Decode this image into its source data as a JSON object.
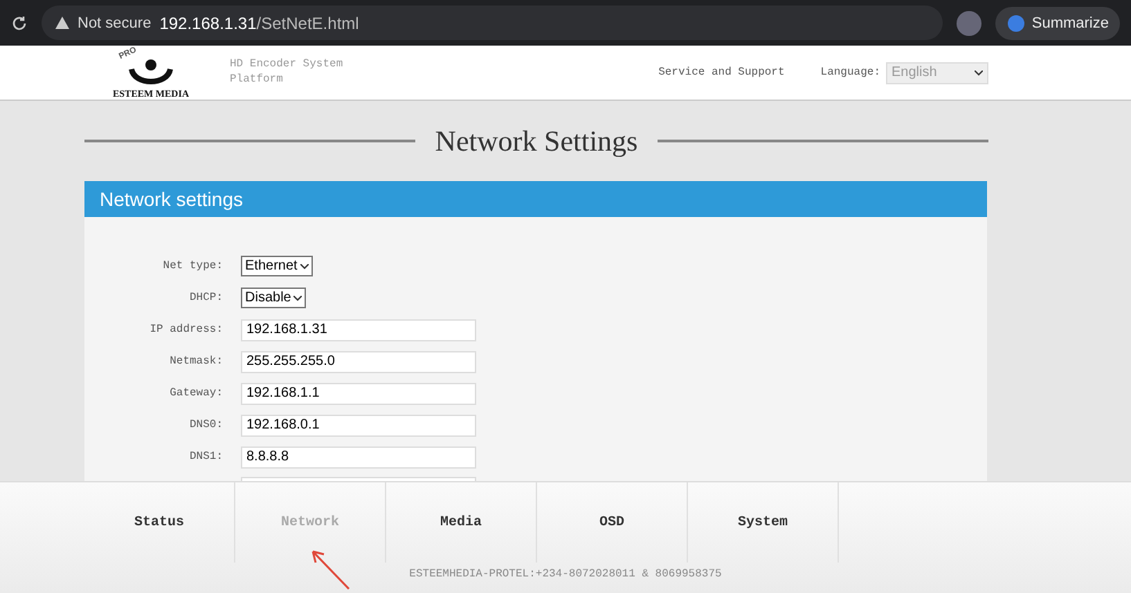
{
  "browser": {
    "security": "Not secure",
    "url_host": "192.168.1.31",
    "url_path": "/SetNetE.html",
    "summarize": "Summarize"
  },
  "header": {
    "logo_badge": "PRO",
    "logo_text": "ESTEEM MEDIA",
    "subtitle": "HD Encoder System Platform",
    "support_link": "Service and Support",
    "language_label": "Language:",
    "language_value": "English"
  },
  "page_title": "Network Settings",
  "panel": {
    "title": "Network settings",
    "fields": [
      {
        "kind": "select",
        "label": "Net type:",
        "value": "Ethernet"
      },
      {
        "kind": "select",
        "label": "DHCP:",
        "value": "Disable"
      },
      {
        "kind": "text",
        "label": "IP address:",
        "value": "192.168.1.31"
      },
      {
        "kind": "text",
        "label": "Netmask:",
        "value": "255.255.255.0"
      },
      {
        "kind": "text",
        "label": "Gateway:",
        "value": "192.168.1.1"
      },
      {
        "kind": "text",
        "label": "DNS0:",
        "value": "192.168.0.1"
      },
      {
        "kind": "text",
        "label": "DNS1:",
        "value": "8.8.8.8"
      },
      {
        "kind": "partial"
      }
    ]
  },
  "nav": [
    {
      "label": "Status",
      "selected": false
    },
    {
      "label": "Network",
      "selected": true
    },
    {
      "label": "Media",
      "selected": false
    },
    {
      "label": "OSD",
      "selected": false
    },
    {
      "label": "System",
      "selected": false
    }
  ],
  "footer": "ESTEEMHEDIA-PROTEL:+234-8072028011 & 8069958375"
}
